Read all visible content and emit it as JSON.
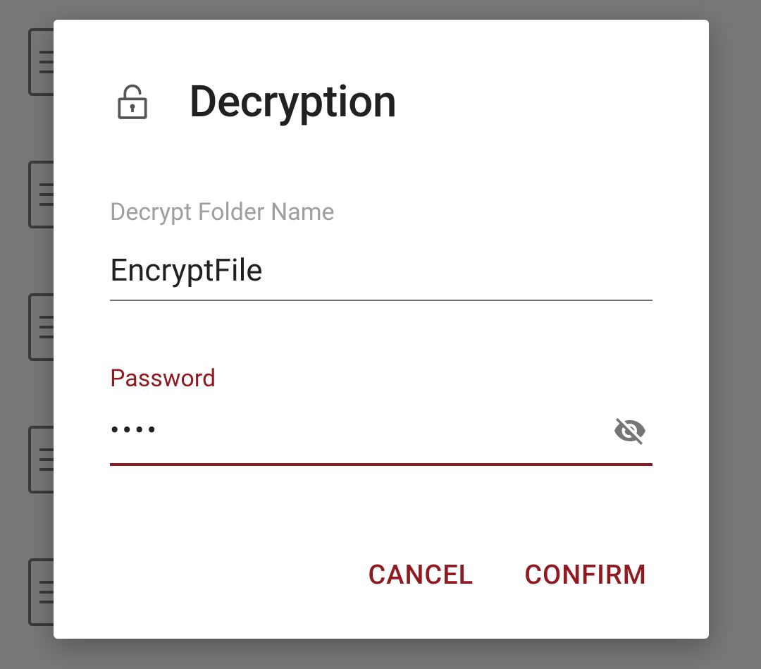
{
  "dialog": {
    "title": "Decryption",
    "folderName": {
      "label": "Decrypt Folder Name",
      "value": "EncryptFile"
    },
    "password": {
      "label": "Password",
      "maskedValue": "••••"
    },
    "actions": {
      "cancel": "CANCEL",
      "confirm": "CONFIRM"
    }
  },
  "colors": {
    "accent": "#8f1a1f",
    "textPrimary": "#212121",
    "textSecondary": "#9e9e9e",
    "iconGray": "#757575"
  }
}
